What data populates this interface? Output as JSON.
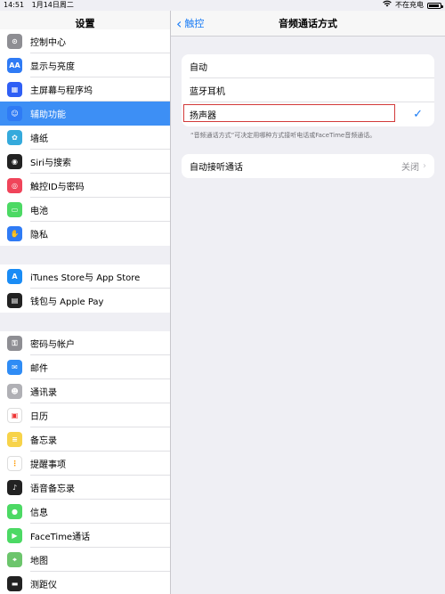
{
  "status": {
    "time": "14:51",
    "date": "1月14日周二",
    "charging": "不在充电",
    "battery_level": 0.9
  },
  "sidebar": {
    "title": "设置",
    "groups": [
      [
        {
          "label": "控制中心",
          "icon": "toggle-icon",
          "color": "#8e8e93"
        },
        {
          "label": "显示与亮度",
          "icon": "aa-icon",
          "color": "#2f7bf5"
        },
        {
          "label": "主屏幕与程序坞",
          "icon": "grid-icon",
          "color": "#2f5ff5"
        },
        {
          "label": "辅助功能",
          "icon": "accessibility-icon",
          "color": "#2f7bf5",
          "selected": true
        },
        {
          "label": "墙纸",
          "icon": "flower-icon",
          "color": "#35aadc"
        },
        {
          "label": "Siri与搜索",
          "icon": "siri-icon",
          "color": "#222"
        },
        {
          "label": "触控ID与密码",
          "icon": "fingerprint-icon",
          "color": "#f0445a"
        },
        {
          "label": "电池",
          "icon": "battery-icon",
          "color": "#4cd964"
        },
        {
          "label": "隐私",
          "icon": "hand-icon",
          "color": "#2f7bf5"
        }
      ],
      [
        {
          "label": "iTunes Store与 App Store",
          "icon": "appstore-icon",
          "color": "#1a8cf5"
        },
        {
          "label": "钱包与 Apple Pay",
          "icon": "wallet-icon",
          "color": "#222"
        }
      ],
      [
        {
          "label": "密码与帐户",
          "icon": "key-icon",
          "color": "#8e8e93"
        },
        {
          "label": "邮件",
          "icon": "mail-icon",
          "color": "#2f8cf5"
        },
        {
          "label": "通讯录",
          "icon": "contacts-icon",
          "color": "#b0b0b5"
        },
        {
          "label": "日历",
          "icon": "calendar-icon",
          "color": "#ffffff"
        },
        {
          "label": "备忘录",
          "icon": "notes-icon",
          "color": "#f7d34a"
        },
        {
          "label": "提醒事项",
          "icon": "reminders-icon",
          "color": "#ffffff"
        },
        {
          "label": "语音备忘录",
          "icon": "voice-memo-icon",
          "color": "#222"
        },
        {
          "label": "信息",
          "icon": "messages-icon",
          "color": "#4cd964"
        },
        {
          "label": "FaceTime通话",
          "icon": "facetime-icon",
          "color": "#4cd964"
        },
        {
          "label": "地图",
          "icon": "maps-icon",
          "color": "#6cc56c"
        },
        {
          "label": "测距仪",
          "icon": "measure-icon",
          "color": "#222"
        }
      ]
    ]
  },
  "detail": {
    "back_label": "触控",
    "title": "音频通话方式",
    "options": [
      {
        "label": "自动",
        "checked": false
      },
      {
        "label": "蓝牙耳机",
        "checked": false
      },
      {
        "label": "扬声器",
        "checked": true
      }
    ],
    "check_glyph": "✓",
    "footnote": "“音频通话方式”可决定用哪种方式接听电话或FaceTime音频通话。",
    "auto_answer": {
      "label": "自动接听通话",
      "value": "关闭",
      "arrow": "›"
    }
  }
}
